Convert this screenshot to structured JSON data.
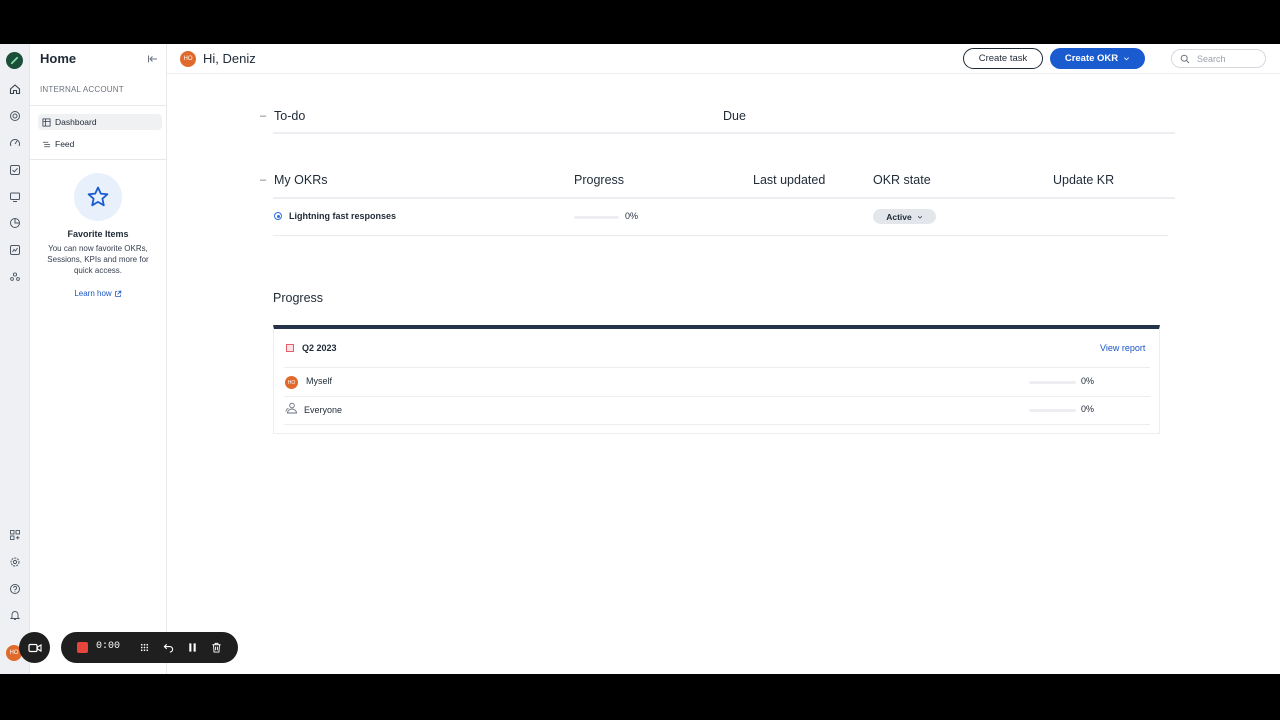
{
  "sidebar": {
    "title": "Home",
    "account_label": "INTERNAL ACCOUNT",
    "items": [
      {
        "label": "Dashboard",
        "icon": "table-icon",
        "active": true
      },
      {
        "label": "Feed",
        "icon": "list-icon",
        "active": false
      }
    ],
    "favorites": {
      "title": "Favorite Items",
      "description": "You can now favorite OKRs, Sessions, KPIs and more for quick access.",
      "link": "Learn how"
    }
  },
  "header": {
    "avatar_initials": "HO",
    "greeting": "Hi, Deniz",
    "create_task_label": "Create task",
    "create_okr_label": "Create OKR",
    "search_placeholder": "Search"
  },
  "todo": {
    "title": "To-do",
    "due_header": "Due"
  },
  "okrs": {
    "title": "My OKRs",
    "columns": {
      "progress": "Progress",
      "last_updated": "Last updated",
      "state": "OKR state",
      "update": "Update KR"
    },
    "rows": [
      {
        "name": "Lightning fast responses",
        "progress_text": "0%",
        "progress": 0,
        "state": "Active"
      }
    ]
  },
  "progress": {
    "title": "Progress",
    "period": "Q2 2023",
    "view_report": "View report",
    "rows": [
      {
        "label": "Myself",
        "percent": "0%",
        "avatar_initials": "HO"
      },
      {
        "label": "Everyone",
        "percent": "0%"
      }
    ]
  },
  "recorder": {
    "time": "0:00"
  },
  "colors": {
    "primary": "#1a5ccf",
    "avatar": "#e06a2b",
    "logo": "#1b4f3a",
    "rec_stop": "#e5453b"
  }
}
